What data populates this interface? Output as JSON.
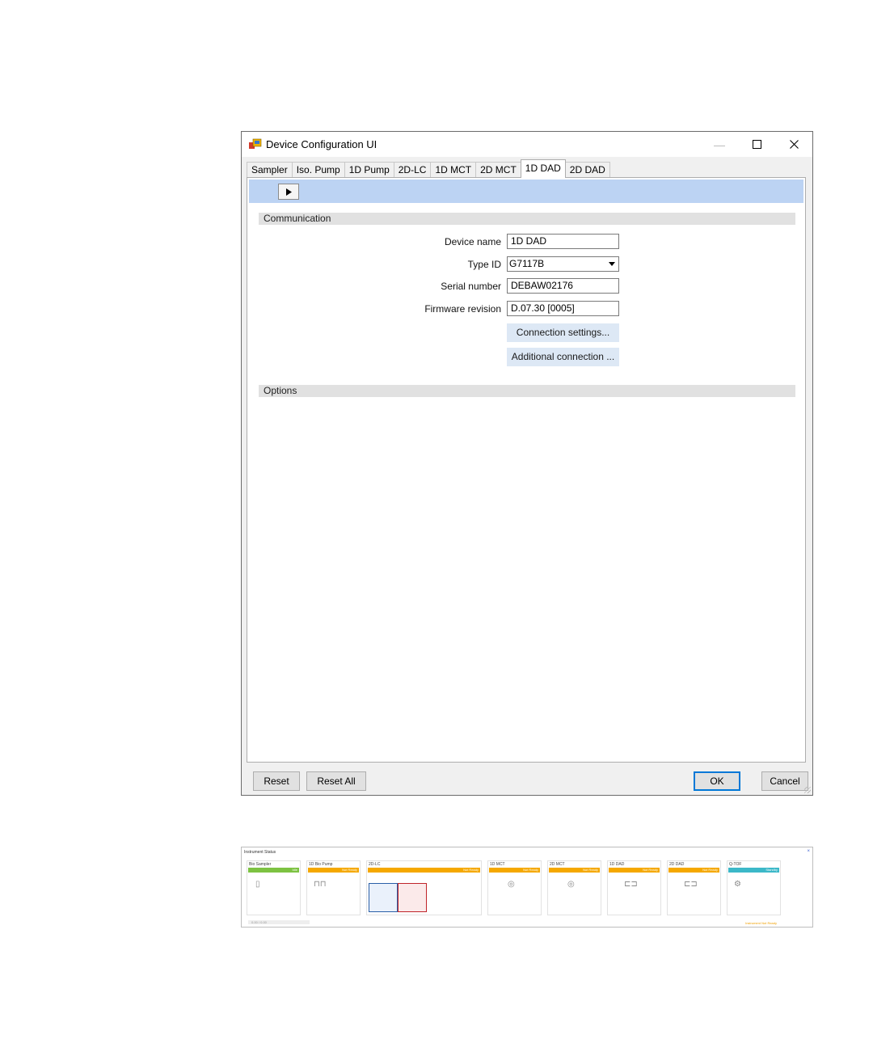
{
  "window": {
    "title": "Device Configuration UI",
    "minimize_glyph": "—",
    "maximize_glyph": "☐",
    "close_glyph": "✕"
  },
  "tabs": [
    {
      "label": "Sampler",
      "active": false
    },
    {
      "label": "Iso. Pump",
      "active": false
    },
    {
      "label": "1D Pump",
      "active": false
    },
    {
      "label": "2D-LC",
      "active": false
    },
    {
      "label": "1D MCT",
      "active": false
    },
    {
      "label": "2D MCT",
      "active": false
    },
    {
      "label": "1D DAD",
      "active": true
    },
    {
      "label": "2D DAD",
      "active": false
    }
  ],
  "communication": {
    "header": "Communication",
    "device_name_label": "Device name",
    "device_name_value": "1D DAD",
    "type_id_label": "Type ID",
    "type_id_value": "G7117B",
    "serial_label": "Serial number",
    "serial_value": "DEBAW02176",
    "firmware_label": "Firmware revision",
    "firmware_value": "D.07.30 [0005]",
    "connection_settings_label": "Connection settings...",
    "additional_connection_label": "Additional connection ..."
  },
  "options": {
    "header": "Options"
  },
  "buttons": {
    "reset": "Reset",
    "reset_all": "Reset All",
    "ok": "OK",
    "cancel": "Cancel"
  },
  "instrument_status": {
    "title": "Instrument Status",
    "close_glyph": "×",
    "modules": [
      {
        "name": "Bio Sampler",
        "state": "Idle",
        "color": "#7dc242"
      },
      {
        "name": "1D Bio Pump",
        "state": "Not Ready",
        "color": "#f5a800"
      },
      {
        "name": "2D-LC",
        "state": "Not Ready",
        "color": "#f5a800"
      },
      {
        "name": "1D MCT",
        "state": "Not Ready",
        "color": "#f5a800"
      },
      {
        "name": "2D MCT",
        "state": "Not Ready",
        "color": "#f5a800"
      },
      {
        "name": "1D DAD",
        "state": "Not Ready",
        "color": "#f5a800"
      },
      {
        "name": "2D DAD",
        "state": "Not Ready",
        "color": "#f5a800"
      },
      {
        "name": "Q-TOF",
        "state": "Standby",
        "color": "#3cb8c8"
      }
    ],
    "footer_time": "0.00 / 0.00",
    "footer_status": "Instrument Not Ready"
  }
}
